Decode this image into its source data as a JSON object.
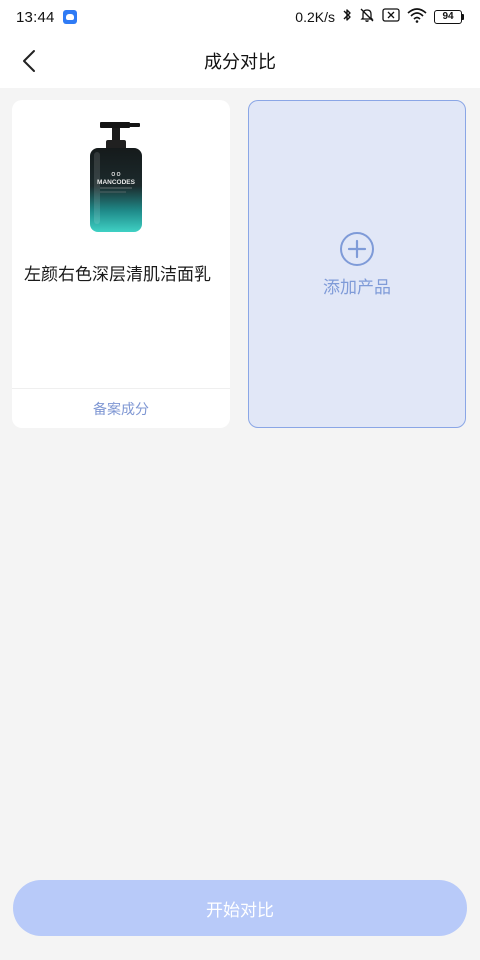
{
  "status_bar": {
    "time": "13:44",
    "net_speed": "0.2K/s",
    "battery": "94"
  },
  "header": {
    "title": "成分对比"
  },
  "product_card": {
    "name": "左颜右色深层清肌洁面乳",
    "image_brand": "MANCODES",
    "filed_ingredients_label": "备案成分"
  },
  "add_card": {
    "label": "添加产品"
  },
  "footer": {
    "compare_label": "开始对比"
  },
  "colors": {
    "accent": "#8aa6e6",
    "add_card_bg": "#e1e7f7",
    "compare_button_bg": "#b8caf9",
    "link_text": "#7f97d3"
  }
}
